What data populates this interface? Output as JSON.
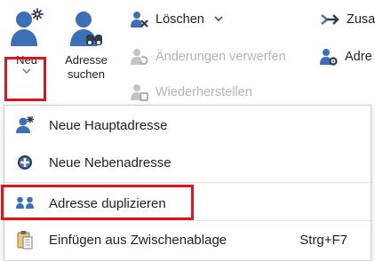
{
  "ribbon": {
    "new_button": {
      "label": "Neu",
      "icon": "person-sparkle-icon"
    },
    "search_address_button": {
      "label": "Adresse\nsuchen",
      "icon": "person-binoculars-icon"
    },
    "delete_button": {
      "label": "Löschen",
      "icon": "person-delete-icon"
    },
    "discard_changes_button": {
      "label": "Änderungen verwerfen",
      "icon": "person-undo-icon"
    },
    "restore_button": {
      "label": "Wiederherstellen",
      "icon": "person-restore-icon"
    },
    "merge_button": {
      "label": "Zusa",
      "icon": "merge-arrow-icon"
    },
    "address_settings_button": {
      "label": "Adre",
      "icon": "person-settings-icon"
    }
  },
  "dropdown_menu": {
    "items": [
      {
        "label": "Neue Hauptadresse",
        "shortcut": "",
        "icon": "main-address-icon"
      },
      {
        "label": "Neue Nebenadresse",
        "shortcut": "",
        "icon": "sub-address-icon"
      },
      {
        "label": "Adresse duplizieren",
        "shortcut": "",
        "icon": "duplicate-address-icon"
      },
      {
        "label": "Einfügen aus Zwischenablage",
        "shortcut": "Strg+F7",
        "icon": "clipboard-paste-icon"
      }
    ]
  },
  "colors": {
    "icon_blue": "#3b6fb6",
    "icon_dark": "#2f3a4a",
    "highlight_red": "#e0141e",
    "disabled_gray": "#b5b5b5"
  }
}
